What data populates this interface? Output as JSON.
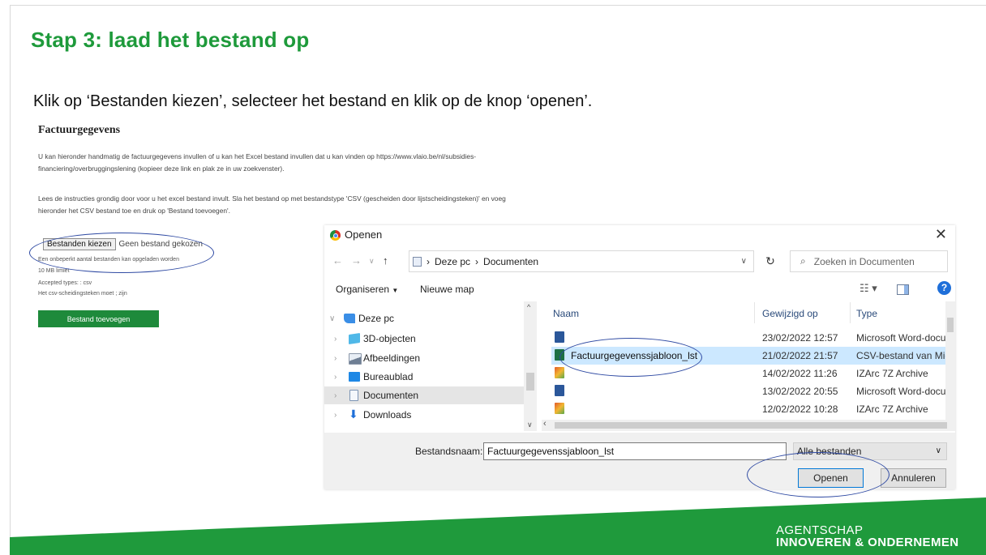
{
  "slide": {
    "title": "Stap 3: laad het bestand op",
    "subtitle": "Klik op ‘Bestanden kiezen’, selecteer het bestand en klik op de knop ‘openen’."
  },
  "form": {
    "heading": "Factuurgegevens",
    "para1_line1": "U kan hieronder handmatig de factuurgegevens invullen of u kan het Excel bestand invullen dat u kan vinden op https://www.vlaio.be/nl/subsidies-",
    "para1_line2": "financiering/overbruggingslening (kopieer deze link en plak ze in uw zoekvenster).",
    "para2_line1": "Lees de instructies grondig door voor u het excel bestand invult. Sla het bestand op met bestandstype 'CSV (gescheiden door lijstscheidingsteken)' en voeg",
    "para2_line2": "hieronder het CSV bestand toe en druk op 'Bestand toevoegen'.",
    "choose_button": "Bestanden kiezen",
    "no_file": "Geen bestand gekozen",
    "note1": "Een onbeperkt aantal bestanden kan opgeladen worden",
    "note2": "10 MB limiet",
    "note3": "Accepted types: : csv",
    "note4": "Het csv-scheidingsteken moet ; zijn",
    "add_button": "Bestand toevoegen"
  },
  "dialog": {
    "title": "Openen",
    "close": "✕",
    "path": [
      "Deze pc",
      "Documenten"
    ],
    "search_placeholder": "Zoeken in Documenten",
    "toolbar": {
      "organize": "Organiseren",
      "new_folder": "Nieuwe map"
    },
    "tree": [
      {
        "label": "Deze pc",
        "icon": "pc-icon"
      },
      {
        "label": "3D-objecten",
        "icon": "cube-icon"
      },
      {
        "label": "Afbeeldingen",
        "icon": "images-icon"
      },
      {
        "label": "Bureaublad",
        "icon": "desktop-icon"
      },
      {
        "label": "Documenten",
        "icon": "documents-icon"
      },
      {
        "label": "Downloads",
        "icon": "download-icon"
      }
    ],
    "columns": {
      "name": "Naam",
      "modified": "Gewijzigd op",
      "type": "Type"
    },
    "files": [
      {
        "name": "",
        "modified": "23/02/2022 12:57",
        "type": "Microsoft Word-document",
        "icon": "word-icon"
      },
      {
        "name": "Factuurgegevenssjabloon_lst",
        "modified": "21/02/2022 21:57",
        "type": "CSV-bestand van Microsoft Excel",
        "icon": "excel-icon"
      },
      {
        "name": "",
        "modified": "14/02/2022 11:26",
        "type": "IZArc 7Z Archive",
        "icon": "archive-icon"
      },
      {
        "name": "",
        "modified": "13/02/2022 20:55",
        "type": "Microsoft Word-document",
        "icon": "word-icon"
      },
      {
        "name": "",
        "modified": "12/02/2022 10:28",
        "type": "IZArc 7Z Archive",
        "icon": "archive-icon"
      }
    ],
    "filename_label": "Bestandsnaam:",
    "filename_value": "Factuurgegevenssjabloon_lst",
    "filetype": "Alle bestanden",
    "open_button": "Openen",
    "cancel_button": "Annuleren"
  },
  "footer": {
    "brand_line1": "AGENTSCHAP",
    "brand_line2": "INNOVEREN & ONDERNEMEN"
  },
  "colors": {
    "title_green": "#1e9a3b",
    "footer_green": "#1f9a3c",
    "selection_blue": "#cce8ff",
    "annotation_blue": "#2f4aa3"
  }
}
